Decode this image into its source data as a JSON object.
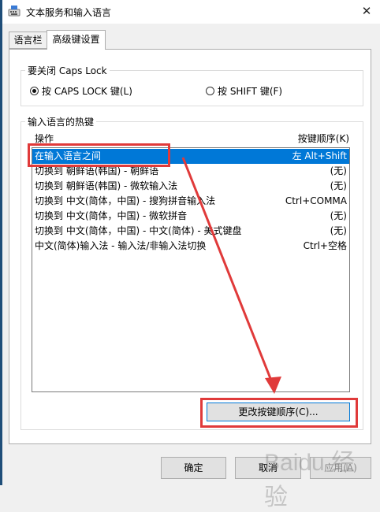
{
  "window": {
    "title": "文本服务和输入语言"
  },
  "tabs": [
    {
      "label": "语言栏"
    },
    {
      "label": "高级键设置"
    }
  ],
  "caps_group": {
    "legend": "要关闭 Caps Lock",
    "options": [
      {
        "label": "按 CAPS LOCK 键(L)",
        "selected": true
      },
      {
        "label": "按 SHIFT 键(F)",
        "selected": false
      }
    ]
  },
  "hotkey_group": {
    "legend": "输入语言的热键",
    "col_action": "操作",
    "col_key": "按键顺序(K)",
    "rows": [
      {
        "action": "在输入语言之间",
        "key": "左 Alt+Shift",
        "selected": true
      },
      {
        "action": "切换到 朝鲜语(韩国) - 朝鲜语",
        "key": "(无)"
      },
      {
        "action": "切换到 朝鲜语(韩国) - 微软输入法",
        "key": "(无)"
      },
      {
        "action": "切换到 中文(简体，中国) - 搜狗拼音输入法",
        "key": "Ctrl+COMMA"
      },
      {
        "action": "切换到 中文(简体，中国) - 微软拼音",
        "key": "(无)"
      },
      {
        "action": "切换到 中文(简体，中国) - 中文(简体) - 美式键盘",
        "key": "(无)"
      },
      {
        "action": "中文(简体)输入法 - 输入法/非输入法切换",
        "key": "Ctrl+空格"
      }
    ],
    "change_button": "更改按键顺序(C)..."
  },
  "footer": {
    "ok": "确定",
    "cancel": "取消",
    "apply": "应用(A)"
  },
  "watermark": "Baidu 经验",
  "colors": {
    "selection": "#0078d7",
    "annotation": "#e03a3a"
  }
}
